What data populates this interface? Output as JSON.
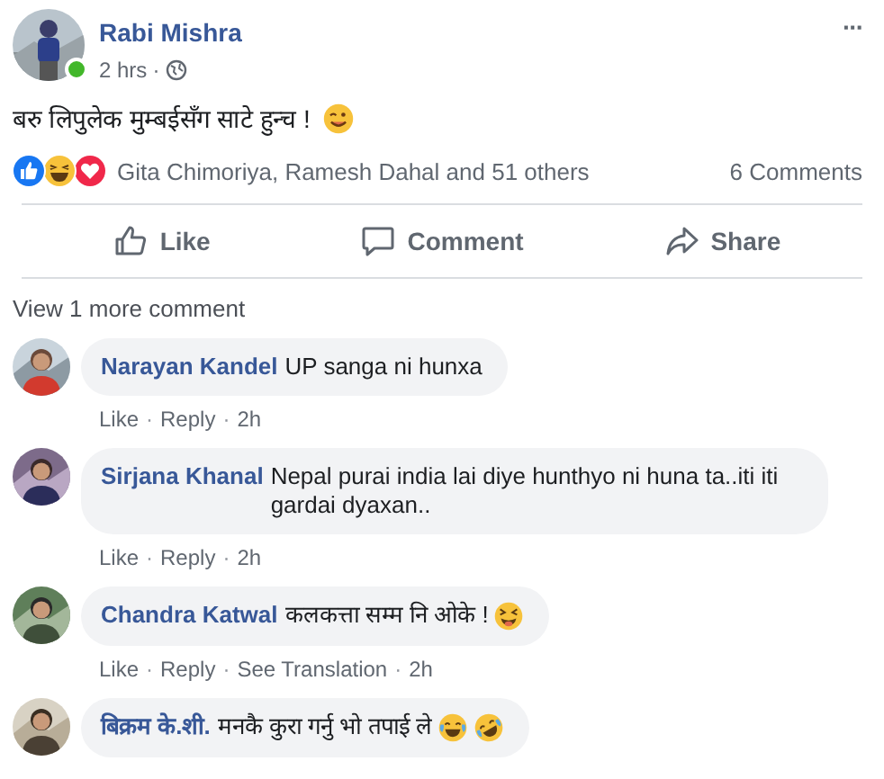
{
  "post": {
    "author": "Rabi Mishra",
    "online": true,
    "time": "2 hrs",
    "separator": "·",
    "more": "···",
    "text": "बरु लिपुलेक मुम्बईसँग साटे हुन्च !",
    "emoji": [
      {
        "kind": "wink"
      }
    ]
  },
  "reactions": {
    "icons": [
      {
        "kind": "like"
      },
      {
        "kind": "haha"
      },
      {
        "kind": "love"
      }
    ],
    "names": "Gita Chimoriya, Ramesh Dahal and 51 others",
    "comments_count": "6 Comments"
  },
  "actions": [
    {
      "kind": "like",
      "label": "Like"
    },
    {
      "kind": "comment",
      "label": "Comment"
    },
    {
      "kind": "share",
      "label": "Share"
    }
  ],
  "view_more": "View 1 more comment",
  "comments": [
    {
      "author": "Narayan Kandel",
      "text": "UP sanga ni hunxa",
      "links": [
        "Like",
        "Reply"
      ],
      "time": "2h"
    },
    {
      "author": "Sirjana Khanal",
      "text": "Nepal purai india lai diye hunthyo ni huna ta..iti iti gardai dyaxan..",
      "links": [
        "Like",
        "Reply"
      ],
      "time": "2h"
    },
    {
      "author": "Chandra Katwal",
      "text": "कलकत्ता सम्म नि ओके !",
      "emoji": [
        {
          "kind": "squint-tongue"
        }
      ],
      "links": [
        "Like",
        "Reply",
        "See Translation"
      ],
      "time": "2h"
    },
    {
      "author": "बिक्रम के.शी.",
      "text": "मनकै कुरा गर्नु भो तपाई ले",
      "emoji": [
        {
          "kind": "joy"
        },
        {
          "kind": "rofl"
        }
      ]
    }
  ]
}
